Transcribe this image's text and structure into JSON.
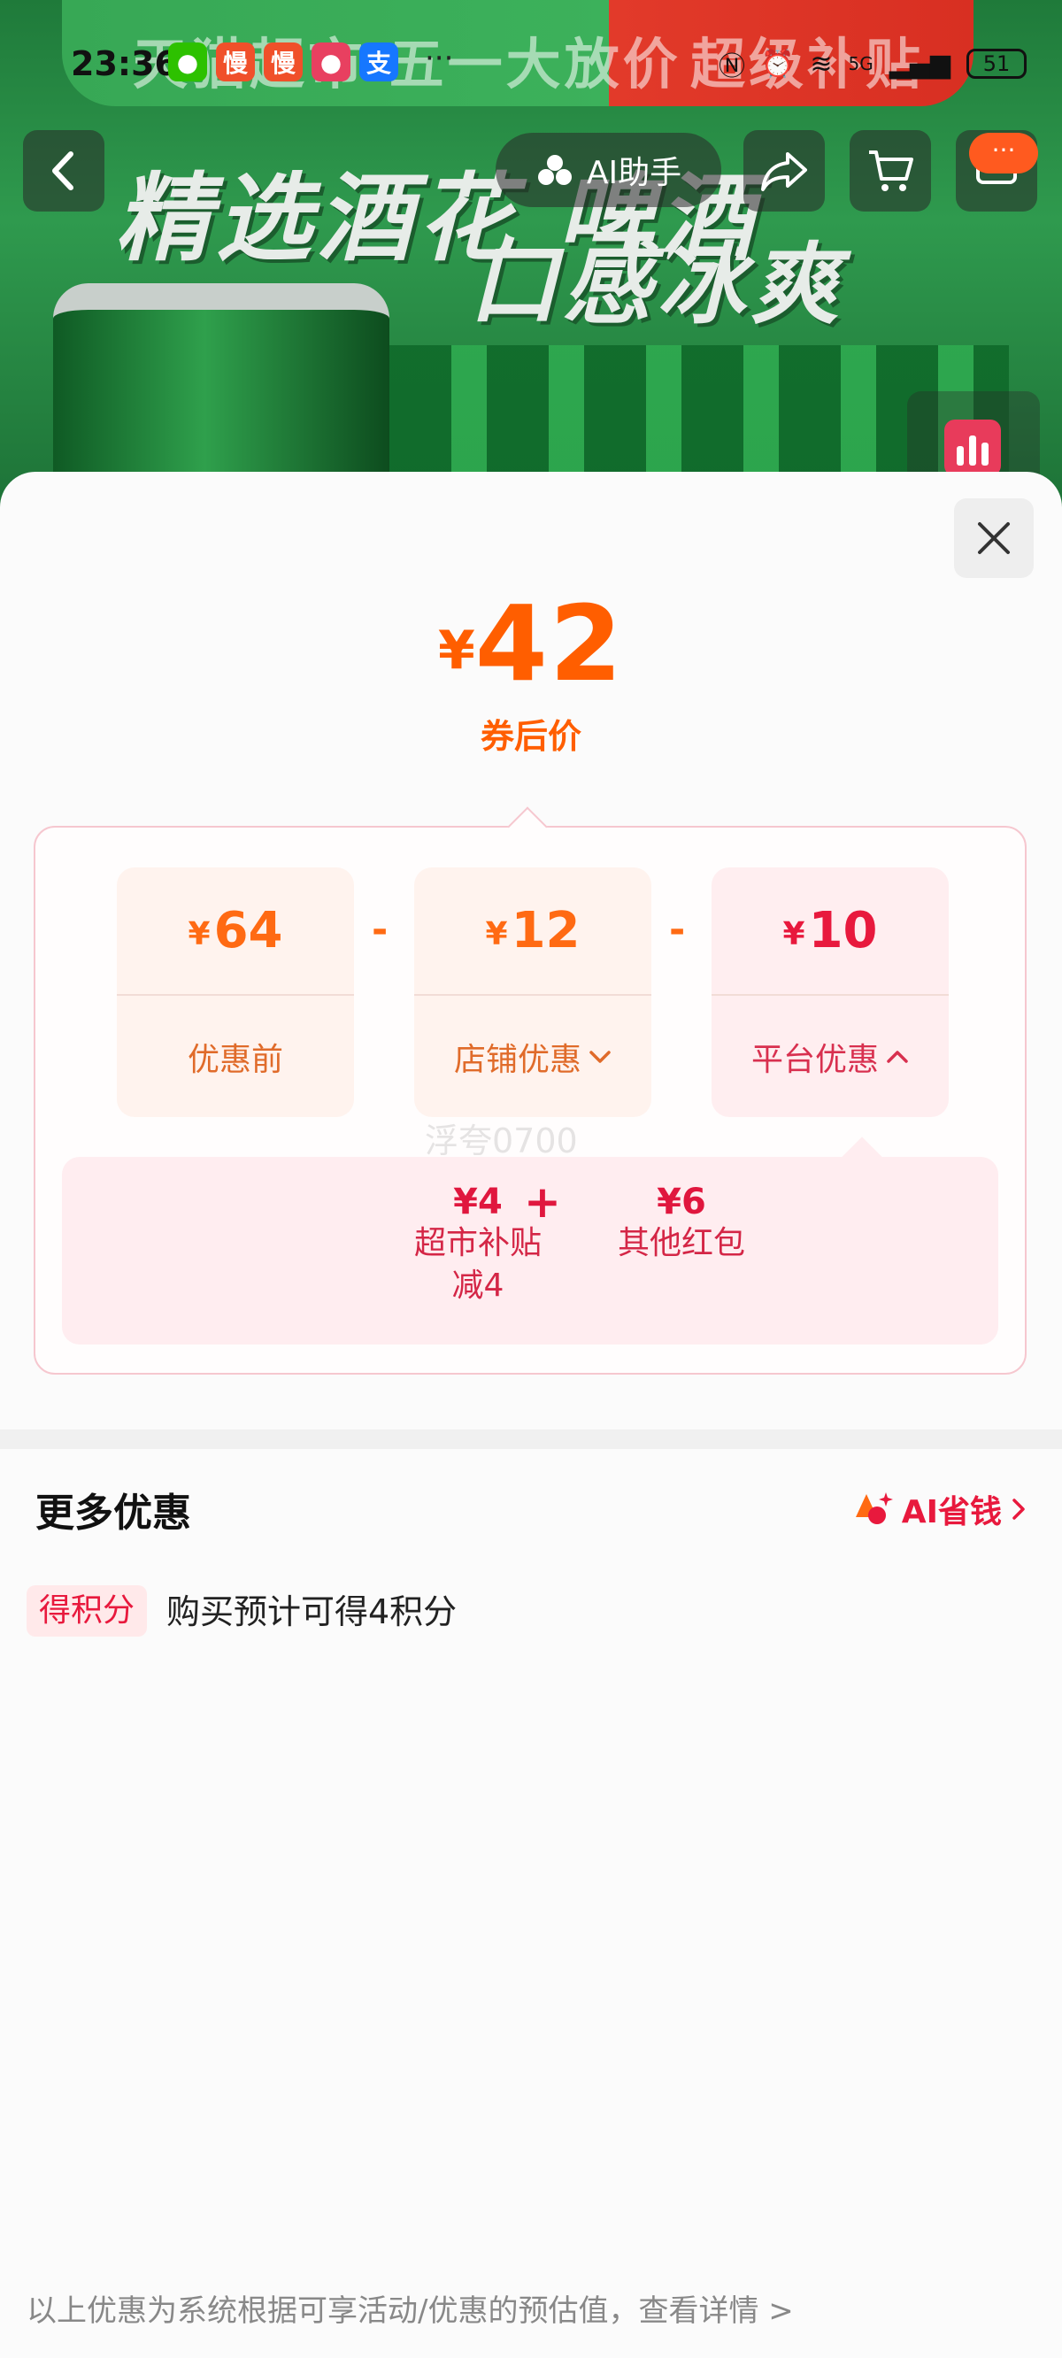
{
  "status_bar": {
    "time": "23:36",
    "apps": [
      {
        "icon": "wechat-icon",
        "glyph": "●",
        "color": "#2dc100"
      },
      {
        "icon": "man-app-icon",
        "glyph": "慢",
        "color": "#f0502a"
      },
      {
        "icon": "man-app-icon",
        "glyph": "慢",
        "color": "#f0502a"
      },
      {
        "icon": "activity-app-icon",
        "glyph": "●",
        "color": "#e84060"
      },
      {
        "icon": "alipay-icon",
        "glyph": "支",
        "color": "#1677ff"
      }
    ],
    "more": "···",
    "network": "5G",
    "battery": "51"
  },
  "banner": {
    "promo_left": "天猫超市 五一大放价",
    "promo_right": "超级补贴",
    "headline_1": "精选酒花 啤酒",
    "headline_2": "口感冰爽"
  },
  "nav": {
    "ai_label": "AI助手",
    "badge": "···"
  },
  "price": {
    "symbol": "¥",
    "final": "42",
    "final_label": "券后价"
  },
  "breakdown": {
    "cards": [
      {
        "symbol": "¥",
        "amount": "64",
        "label": "优惠前",
        "chevron": ""
      },
      {
        "symbol": "¥",
        "amount": "12",
        "label": "店铺优惠",
        "chevron": "down"
      },
      {
        "symbol": "¥",
        "amount": "10",
        "label": "平台优惠",
        "chevron": "up"
      }
    ],
    "operator": "-",
    "platform_items": [
      {
        "value": "¥4",
        "title": "超市补贴",
        "detail": "减4"
      },
      {
        "value": "¥6",
        "title": "其他红包",
        "detail": ""
      }
    ],
    "plus": "+"
  },
  "watermark": "浮夸0700",
  "more_offers": {
    "title": "更多优惠",
    "ai_save": "AI省钱",
    "points_tag": "得积分",
    "points_text": "购买预计可得4积分"
  },
  "footer_note": "以上优惠为系统根据可享活动/优惠的预估值，查看详情 >"
}
